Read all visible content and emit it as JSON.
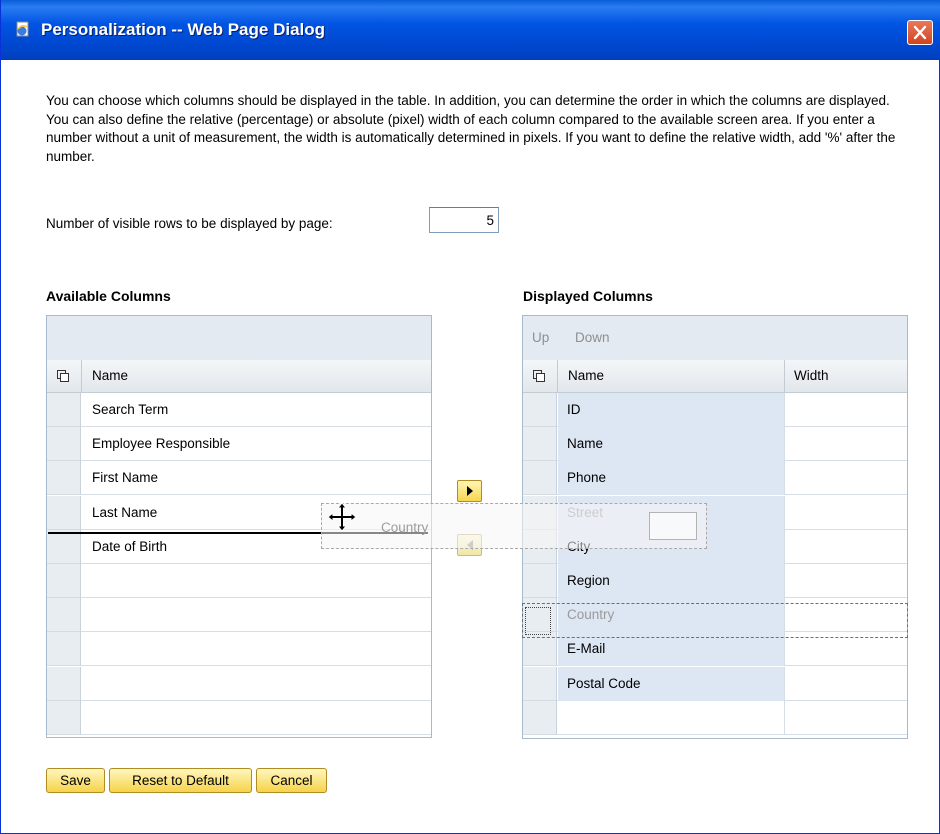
{
  "window": {
    "title": "Personalization -- Web Page Dialog"
  },
  "description": "You can choose which columns should be displayed in the table. In addition, you can determine the order in which the columns are displayed. You can also define the relative (percentage) or absolute (pixel) width of each column compared to the available screen area. If you enter a number without a unit of measurement, the width is automatically determined in pixels. If you want to define the relative width, add '%' after the number.",
  "rows_setting": {
    "label": "Number of visible rows to be displayed by page:",
    "value": "5"
  },
  "available": {
    "title": "Available Columns",
    "header_name": "Name",
    "rows": [
      "Search Term",
      "Employee Responsible",
      "First Name",
      "Last Name",
      "Date of Birth"
    ]
  },
  "displayed": {
    "title": "Displayed Columns",
    "toolbar_up": "Up",
    "toolbar_down": "Down",
    "header_name": "Name",
    "header_width": "Width",
    "rows": [
      "ID",
      "Name",
      "Phone",
      "Street",
      "City",
      "Region",
      "Country",
      "E-Mail",
      "Postal Code"
    ]
  },
  "drag": {
    "ghost_label": "Country",
    "ghost_street": "Street"
  },
  "buttons": {
    "save": "Save",
    "reset": "Reset to Default",
    "cancel": "Cancel"
  },
  "colors": {
    "titlebar": "#0054e3",
    "button_face": "#f6d34a",
    "selected_row": "#dde7f3"
  }
}
